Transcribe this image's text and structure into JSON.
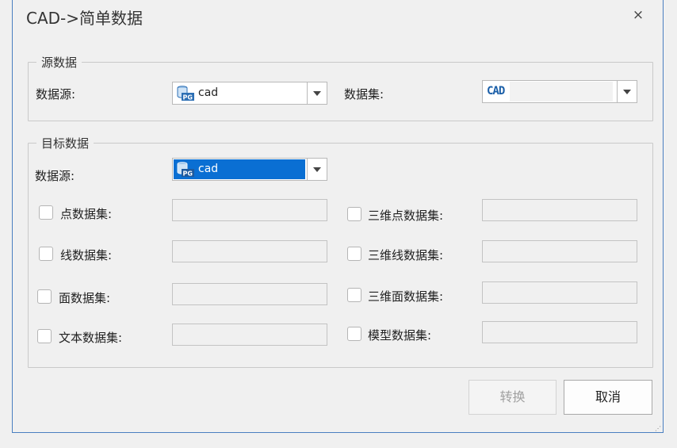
{
  "dialog": {
    "title": "CAD->简单数据",
    "close_glyph": "×"
  },
  "source_group": {
    "legend": "源数据",
    "datasource_label": "数据源:",
    "datasource_value": "cad",
    "dataset_label": "数据集:",
    "dataset_value": "CAD"
  },
  "target_group": {
    "legend": "目标数据",
    "datasource_label": "数据源:",
    "datasource_value": "cad",
    "left_items": [
      {
        "label": "点数据集:",
        "checked": false,
        "value": ""
      },
      {
        "label": "线数据集:",
        "checked": false,
        "value": ""
      },
      {
        "label": "面数据集:",
        "checked": false,
        "value": ""
      },
      {
        "label": "文本数据集:",
        "checked": false,
        "value": ""
      }
    ],
    "right_items": [
      {
        "label": "三维点数据集:",
        "checked": false,
        "value": ""
      },
      {
        "label": "三维线数据集:",
        "checked": false,
        "value": ""
      },
      {
        "label": "三维面数据集:",
        "checked": false,
        "value": ""
      },
      {
        "label": "模型数据集:",
        "checked": false,
        "value": ""
      }
    ]
  },
  "buttons": {
    "convert": "转换",
    "convert_enabled": false,
    "cancel": "取消"
  },
  "icons": {
    "datasource": "postgis-database-icon",
    "dropdown": "chevron-down-icon"
  },
  "colors": {
    "selection": "#0a6fd3",
    "window_border": "#4a7fc0"
  }
}
